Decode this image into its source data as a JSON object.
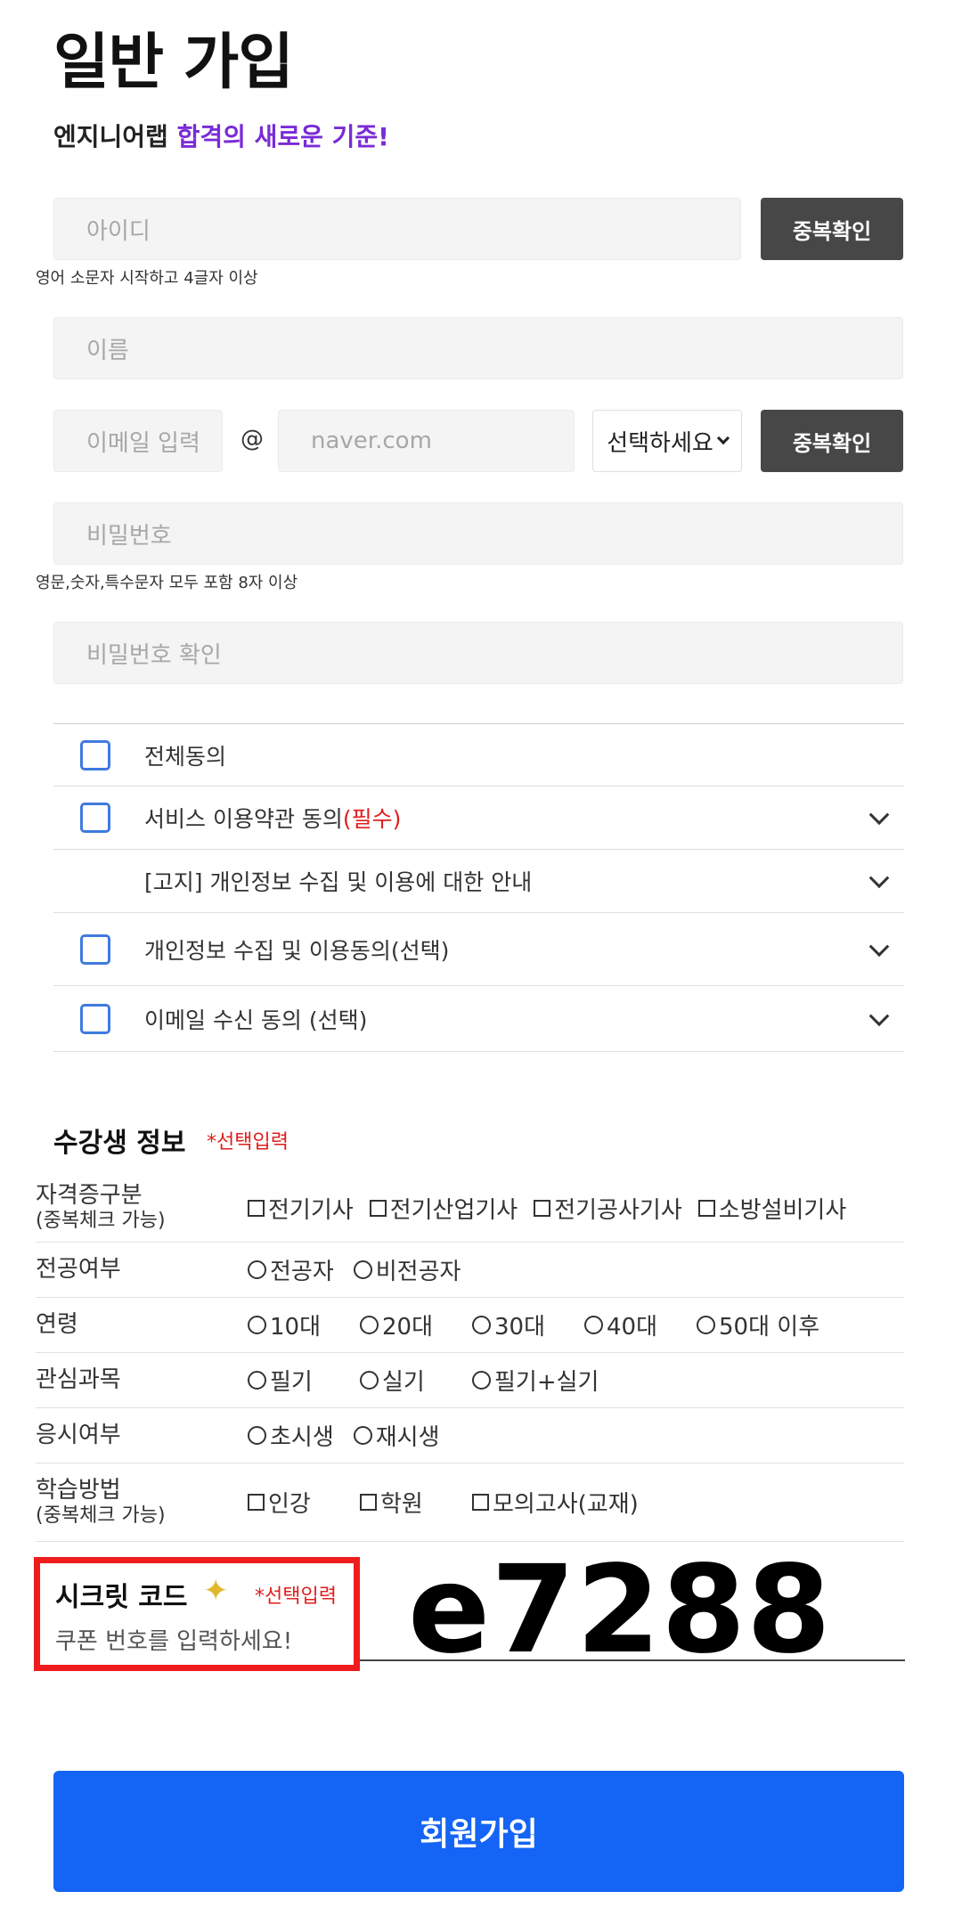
{
  "page": {
    "title": "일반 가입",
    "subtitle_main": "엔지니어랩 ",
    "subtitle_accent": "합격의 새로운 기준!"
  },
  "form": {
    "id_placeholder": "아이디",
    "dup_check": "중복확인",
    "id_hint": "영어 소문자 시작하고 4글자 이상",
    "name_placeholder": "이름",
    "email_placeholder": "이메일 입력",
    "email_at": "@",
    "email_domain_placeholder": "naver.com",
    "email_select": "선택하세요",
    "password_placeholder": "비밀번호",
    "password_hint": "영문,숫자,특수문자 모두 포함 8자 이상",
    "password_confirm_placeholder": "비밀번호 확인"
  },
  "agreements": [
    {
      "label": "전체동의",
      "required": ""
    },
    {
      "label": "서비스 이용약관 동의",
      "required": "(필수)"
    },
    {
      "label": "[고지] 개인정보 수집 및 이용에 대한 안내",
      "required": ""
    },
    {
      "label": "개인정보 수집 및 이용동의(선택)",
      "required": ""
    },
    {
      "label": "이메일 수신 동의 (선택)",
      "required": ""
    }
  ],
  "student_info": {
    "title": "수강생 정보",
    "note": "*선택입력",
    "rows": [
      {
        "label": "자격증구분",
        "sub": "(중복체크 가능)",
        "options": [
          "전기기사",
          "전기산업기사",
          "전기공사기사",
          "소방설비기사"
        ]
      },
      {
        "label": "전공여부",
        "sub": "",
        "options": [
          "전공자",
          "비전공자"
        ]
      },
      {
        "label": "연령",
        "sub": "",
        "options": [
          "10대",
          "20대",
          "30대",
          "40대",
          "50대 이후"
        ]
      },
      {
        "label": "관심과목",
        "sub": "",
        "options": [
          "필기",
          "실기",
          "필기+실기"
        ]
      },
      {
        "label": "응시여부",
        "sub": "",
        "options": [
          "초시생",
          "재시생"
        ]
      },
      {
        "label": "학습방법",
        "sub": "(중복체크 가능)",
        "options": [
          "인강",
          "학원",
          "모의고사(교재)"
        ]
      }
    ]
  },
  "secret": {
    "title": "시크릿 코드",
    "note": "*선택입력",
    "hint": "쿠폰 번호를 입력하세요!",
    "code": "e7288"
  },
  "submit": "회원가입"
}
